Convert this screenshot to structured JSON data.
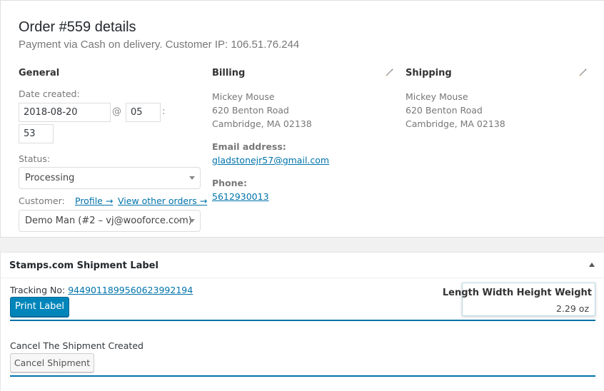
{
  "order": {
    "title": "Order #559 details",
    "subtitle": "Payment via Cash on delivery. Customer IP: 106.51.76.244"
  },
  "general": {
    "heading": "General",
    "date_label": "Date created:",
    "date_value": "2018-08-20",
    "at_symbol": "@",
    "hour_value": "05",
    "colon": ":",
    "minute_value": "53",
    "status_label": "Status:",
    "status_value": "Processing",
    "customer_label": "Customer:",
    "profile_link": "Profile →",
    "other_orders_link": "View other orders →",
    "customer_value": "Demo Man (#2 – vj@wooforce.com)",
    "clear_symbol": "×"
  },
  "billing": {
    "heading": "Billing",
    "name": "Mickey Mouse",
    "street": "620 Benton Road",
    "city": "Cambridge, MA 02138",
    "email_label": "Email address:",
    "email": "gladstonejr57@gmail.com",
    "phone_label": "Phone:",
    "phone": "5612930013"
  },
  "shipping": {
    "heading": "Shipping",
    "name": "Mickey Mouse",
    "street": "620 Benton Road",
    "city": "Cambridge, MA 02138"
  },
  "stamps": {
    "title": "Stamps.com Shipment Label",
    "tracking_label": "Tracking No:",
    "tracking_number": "9449011899560623992194",
    "print_button": "Print Label",
    "dims_header": "Length Width Height Weight",
    "weight_value": "2.29 oz",
    "cancel_label": "Cancel The Shipment Created",
    "cancel_button": "Cancel Shipment"
  },
  "colors": {
    "accent": "#0073aa",
    "primary_button": "#0085ba"
  }
}
